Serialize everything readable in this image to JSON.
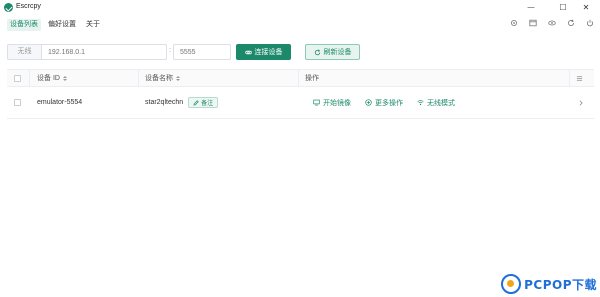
{
  "window": {
    "title": "Escrcpy",
    "minimize": "—",
    "maximize": "☐",
    "close": "✕"
  },
  "tabs": [
    {
      "label": "设备列表",
      "active": true
    },
    {
      "label": "偏好设置",
      "active": false
    },
    {
      "label": "关于",
      "active": false
    }
  ],
  "toolbar_icons": [
    "settings-icon",
    "window-icon",
    "eye-icon",
    "refresh-icon",
    "power-icon"
  ],
  "connection": {
    "mode_label": "无线",
    "ip_placeholder": "192.168.0.1",
    "separator": ":",
    "port_placeholder": "5555",
    "connect_label": "连接设备",
    "refresh_label": "刷新设备"
  },
  "table": {
    "headers": {
      "device_id": "设备 ID",
      "device_name": "设备名称",
      "actions": "操作"
    },
    "rows": [
      {
        "device_id": "emulator-5554",
        "device_name": "star2qltechn",
        "note_label": "备注",
        "actions": {
          "mirror": "开始镜像",
          "more": "更多操作",
          "wireless": "无线模式"
        }
      }
    ]
  },
  "watermark": {
    "text": "PCPOP下载"
  },
  "colors": {
    "accent": "#1c8a6a",
    "accent_light": "#e8f4ef",
    "watermark_blue": "#1f6fd8",
    "watermark_orange": "#f0a51a"
  }
}
